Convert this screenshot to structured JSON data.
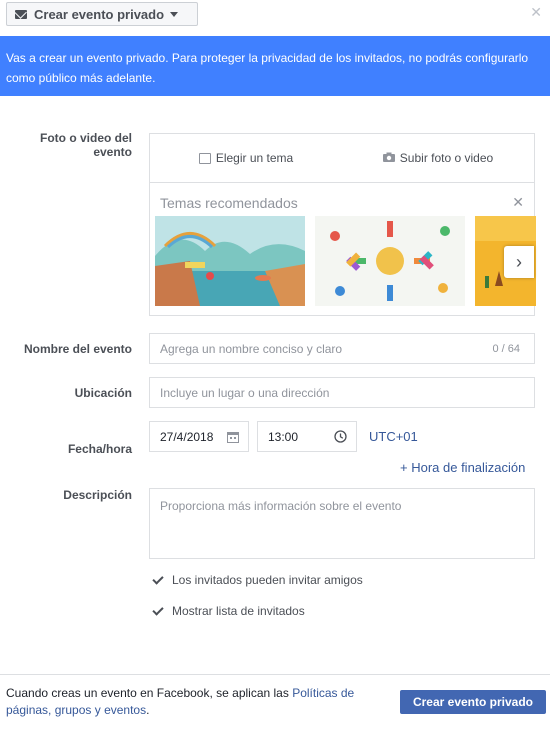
{
  "header": {
    "type_selector_label": "Crear evento privado",
    "close_label": "✕"
  },
  "banner": {
    "text": "Vas a crear un evento privado. Para proteger la privacidad de los invitados, no podrás configurarlo como público más adelante."
  },
  "form": {
    "media_label": "Foto o video del evento",
    "media_tabs": {
      "theme": "Elegir un tema",
      "upload": "Subir foto o video"
    },
    "themes_title": "Temas recomendados",
    "themes_close": "✕",
    "next_glyph": "›",
    "name_label": "Nombre del evento",
    "name_placeholder": "Agrega un nombre conciso y claro",
    "name_counter": "0 / 64",
    "location_label": "Ubicación",
    "location_placeholder": "Incluye un lugar o una dirección",
    "datetime_label": "Fecha/hora",
    "date_value": "27/4/2018",
    "time_value": "13:00",
    "timezone": "UTC+01",
    "end_time_link": "+ Hora de finalización",
    "description_label": "Descripción",
    "description_placeholder": "Proporciona más información sobre el evento",
    "option_invite_friends": "Los invitados pueden invitar amigos",
    "option_show_guest_list": "Mostrar lista de invitados"
  },
  "footer": {
    "policy_prefix": "Cuando creas un evento en Facebook, se aplican las ",
    "policy_link": "Políticas de páginas, grupos y eventos",
    "policy_suffix": ".",
    "create_button": "Crear evento privado"
  },
  "colors": {
    "banner_bg": "#4080ff",
    "primary_button": "#4267b2",
    "link": "#365899"
  },
  "icons": [
    "mail-icon",
    "caret-down-icon",
    "close-icon",
    "theme-icon",
    "camera-icon",
    "chevron-right-icon",
    "calendar-icon",
    "clock-icon",
    "checkbox-checked-icon"
  ]
}
